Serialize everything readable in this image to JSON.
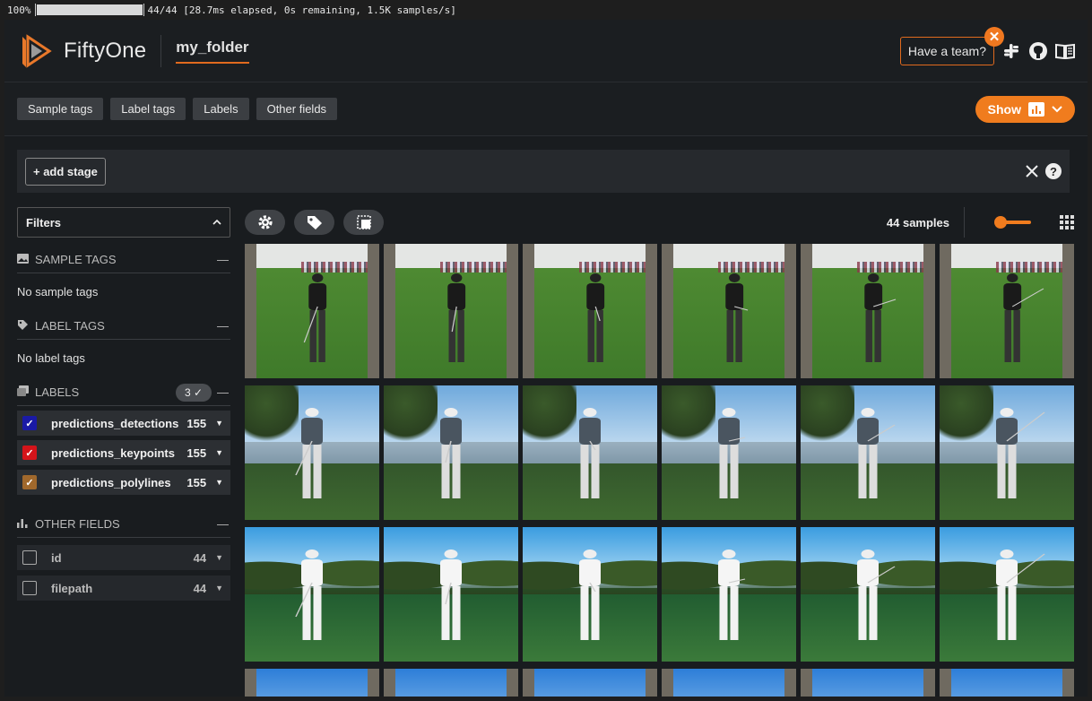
{
  "progress": {
    "percent": "100%",
    "fraction": 1.0,
    "status": "44/44 [28.7ms elapsed, 0s remaining, 1.5K samples/s]"
  },
  "header": {
    "app_name": "FiftyOne",
    "dataset_name": "my_folder",
    "team_button": "Have a team?",
    "icons": [
      "slack-icon",
      "github-icon",
      "docs-book-icon"
    ]
  },
  "tagbar": {
    "chips": [
      "Sample tags",
      "Label tags",
      "Labels",
      "Other fields"
    ],
    "show_button": "Show"
  },
  "stagebar": {
    "add_stage": "+ add stage"
  },
  "sidebar": {
    "filters_label": "Filters",
    "sample_tags": {
      "title": "SAMPLE TAGS",
      "empty": "No sample tags"
    },
    "label_tags": {
      "title": "LABEL TAGS",
      "empty": "No label tags"
    },
    "labels": {
      "title": "LABELS",
      "badge": "3 ✓",
      "items": [
        {
          "name": "predictions_detections",
          "count": "155",
          "color": "#1a1aa6"
        },
        {
          "name": "predictions_keypoints",
          "count": "155",
          "color": "#d4141a"
        },
        {
          "name": "predictions_polylines",
          "count": "155",
          "color": "#a0682c"
        }
      ]
    },
    "other_fields": {
      "title": "OTHER FIELDS",
      "items": [
        {
          "name": "id",
          "count": "44"
        },
        {
          "name": "filepath",
          "count": "44"
        }
      ]
    }
  },
  "main": {
    "sample_count": "44 samples",
    "zoom_fraction": 0.1
  },
  "colors": {
    "accent": "#f07c1e",
    "background": "#191c1f"
  }
}
